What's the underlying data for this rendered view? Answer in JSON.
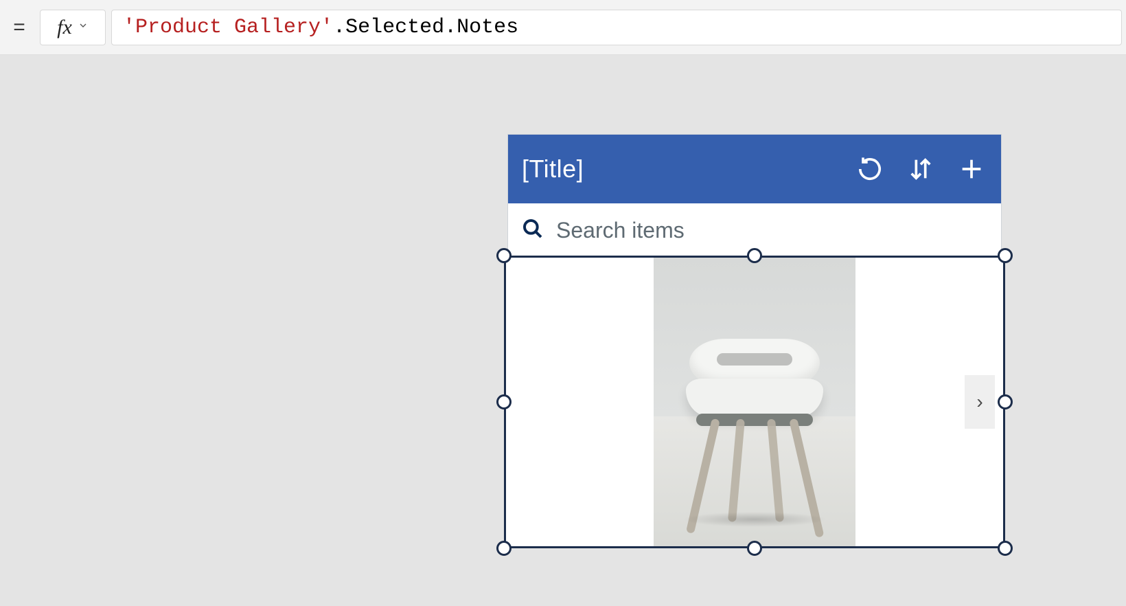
{
  "formula_bar": {
    "equals": "=",
    "fx_label": "fx",
    "formula_string_token": "'Product Gallery'",
    "formula_suffix_1": ".Selected",
    "formula_suffix_2": ".Notes"
  },
  "app_header": {
    "title": "[Title]",
    "refresh_icon": "refresh",
    "sort_icon": "sort",
    "add_icon": "add"
  },
  "search": {
    "placeholder": "Search items",
    "value": ""
  },
  "gallery": {
    "next_arrow_label": "›"
  }
}
